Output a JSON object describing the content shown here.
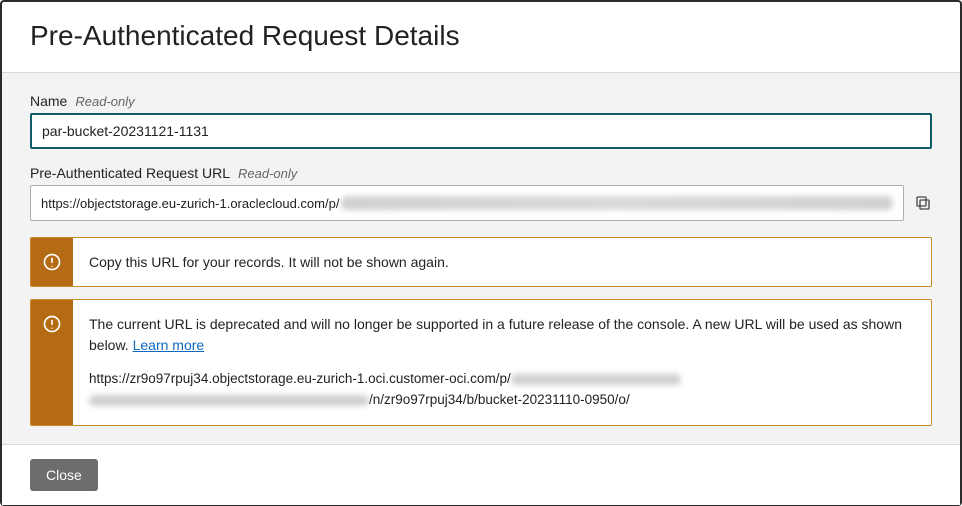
{
  "header": {
    "title": "Pre-Authenticated Request Details"
  },
  "fields": {
    "name": {
      "label": "Name",
      "readonly_hint": "Read-only",
      "value": "par-bucket-20231121-1131"
    },
    "url": {
      "label": "Pre-Authenticated Request URL",
      "readonly_hint": "Read-only",
      "visible_prefix": "https://objectstorage.eu-zurich-1.oraclecloud.com/p/"
    }
  },
  "alerts": {
    "copy_notice": "Copy this URL for your records. It will not be shown again.",
    "deprecated": {
      "text_prefix": "The current URL is deprecated and will no longer be supported in a future release of the console. A new URL will be used as shown below. ",
      "learn_more": "Learn more",
      "new_url_prefix": "https://zr9o97rpuj34.objectstorage.eu-zurich-1.oci.customer-oci.com/p/",
      "new_url_suffix": "/n/zr9o97rpuj34/b/bucket-20231110-0950/o/"
    }
  },
  "footer": {
    "close_label": "Close"
  }
}
